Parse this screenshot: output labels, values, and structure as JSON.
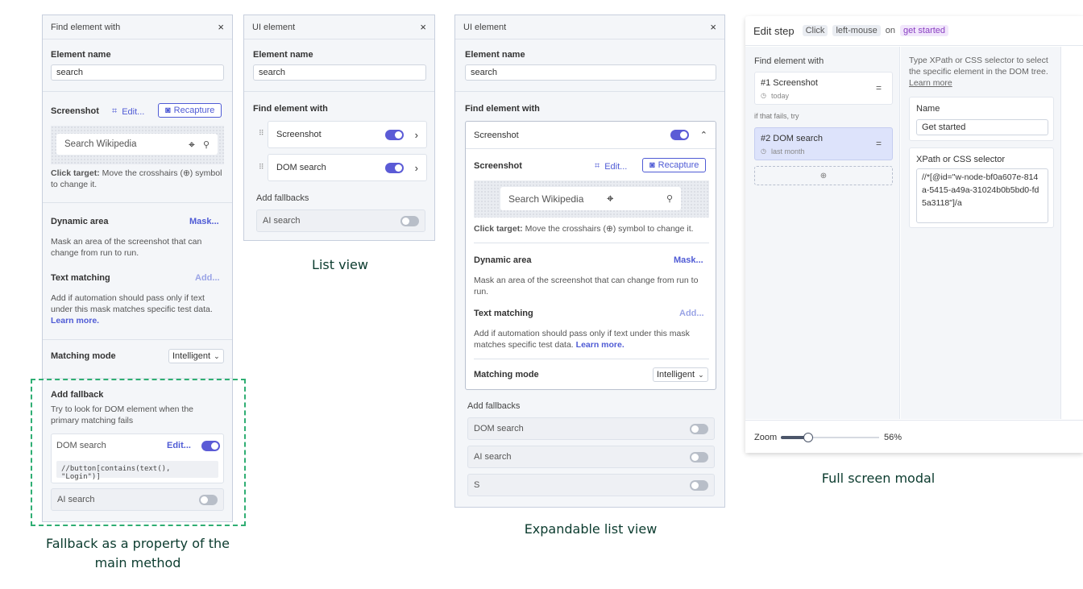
{
  "p1": {
    "header": "Find element with",
    "close": "×",
    "element_name_label": "Element name",
    "element_name_value": "search",
    "screenshot_label": "Screenshot",
    "edit": "Edit...",
    "recapture": "Recapture",
    "search_placeholder": "Search Wikipedia",
    "click_target_label": "Click target:",
    "click_target_text": "Move the crosshairs (⊕) symbol to change it.",
    "dynamic_area_label": "Dynamic area",
    "mask": "Mask...",
    "dynamic_area_text": "Mask an area of the screenshot that can change from run to run.",
    "text_matching_label": "Text matching",
    "add": "Add...",
    "text_matching_text": "Add if automation should pass only if text under this mask matches specific test data.",
    "learn_more": "Learn more.",
    "matching_mode_label": "Matching mode",
    "matching_mode_value": "Intelligent",
    "add_fallback_label": "Add fallback",
    "add_fallback_text": "Try to look for DOM element when the primary matching fails",
    "dom_search": "DOM search",
    "dom_edit": "Edit...",
    "dom_code": "//button[contains(text(), \"Login\")]",
    "ai_search": "AI search"
  },
  "p2": {
    "header": "UI element",
    "close": "×",
    "element_name_label": "Element name",
    "element_name_value": "search",
    "find_label": "Find element with",
    "items": [
      {
        "label": "Screenshot",
        "on": true
      },
      {
        "label": "DOM search",
        "on": true
      }
    ],
    "add_fallbacks": "Add fallbacks",
    "ai_search": "AI search"
  },
  "p3": {
    "header": "UI element",
    "close": "×",
    "element_name_label": "Element name",
    "element_name_value": "search",
    "find_label": "Find element with",
    "screenshot_row": "Screenshot",
    "screenshot_label": "Screenshot",
    "edit": "Edit...",
    "recapture": "Recapture",
    "search_placeholder": "Search Wikipedia",
    "click_target_label": "Click target:",
    "click_target_text": "Move the crosshairs (⊕) symbol to change it.",
    "dynamic_area_label": "Dynamic area",
    "mask": "Mask...",
    "dynamic_area_text": "Mask an area of the screenshot that can change from run to run.",
    "text_matching_label": "Text matching",
    "add": "Add...",
    "text_matching_text": "Add if automation should pass only if text under this mask matches specific test data.",
    "learn_more": "Learn more.",
    "matching_mode_label": "Matching mode",
    "matching_mode_value": "Intelligent",
    "add_fallbacks": "Add fallbacks",
    "fallbacks": [
      "DOM search",
      "AI search",
      "S"
    ]
  },
  "p4": {
    "title": "Edit step",
    "tag_click": "Click",
    "tag_mouse": "left-mouse",
    "on": "on",
    "tag_target": "get started",
    "find_label": "Find element with",
    "item1_title": "#1 Screenshot",
    "item1_time": "today",
    "fails_text": "if that fails, try",
    "item2_title": "#2 DOM search",
    "item2_time": "last month",
    "help_text": "Type XPath or CSS selector to select the specific element in the DOM tree.",
    "learn_more": "Learn more",
    "name_label": "Name",
    "name_value": "Get started",
    "selector_label": "XPath or CSS selector",
    "selector_value": "//*[@id=\"w-node-bf0a607e-814a-5415-a49a-31024b0b5bd0-fd5a3118\"]/a",
    "zoom_label": "Zoom",
    "zoom_value": "56%",
    "zoom_fraction": 0.28
  },
  "captions": {
    "fallback": "Fallback as a property of the main method",
    "list": "List view",
    "expandable": "Expandable list view",
    "modal": "Full screen modal"
  },
  "colors": {
    "accent": "#4f5bd5",
    "dashed": "#2fae73",
    "caption": "#0b3b2e"
  }
}
